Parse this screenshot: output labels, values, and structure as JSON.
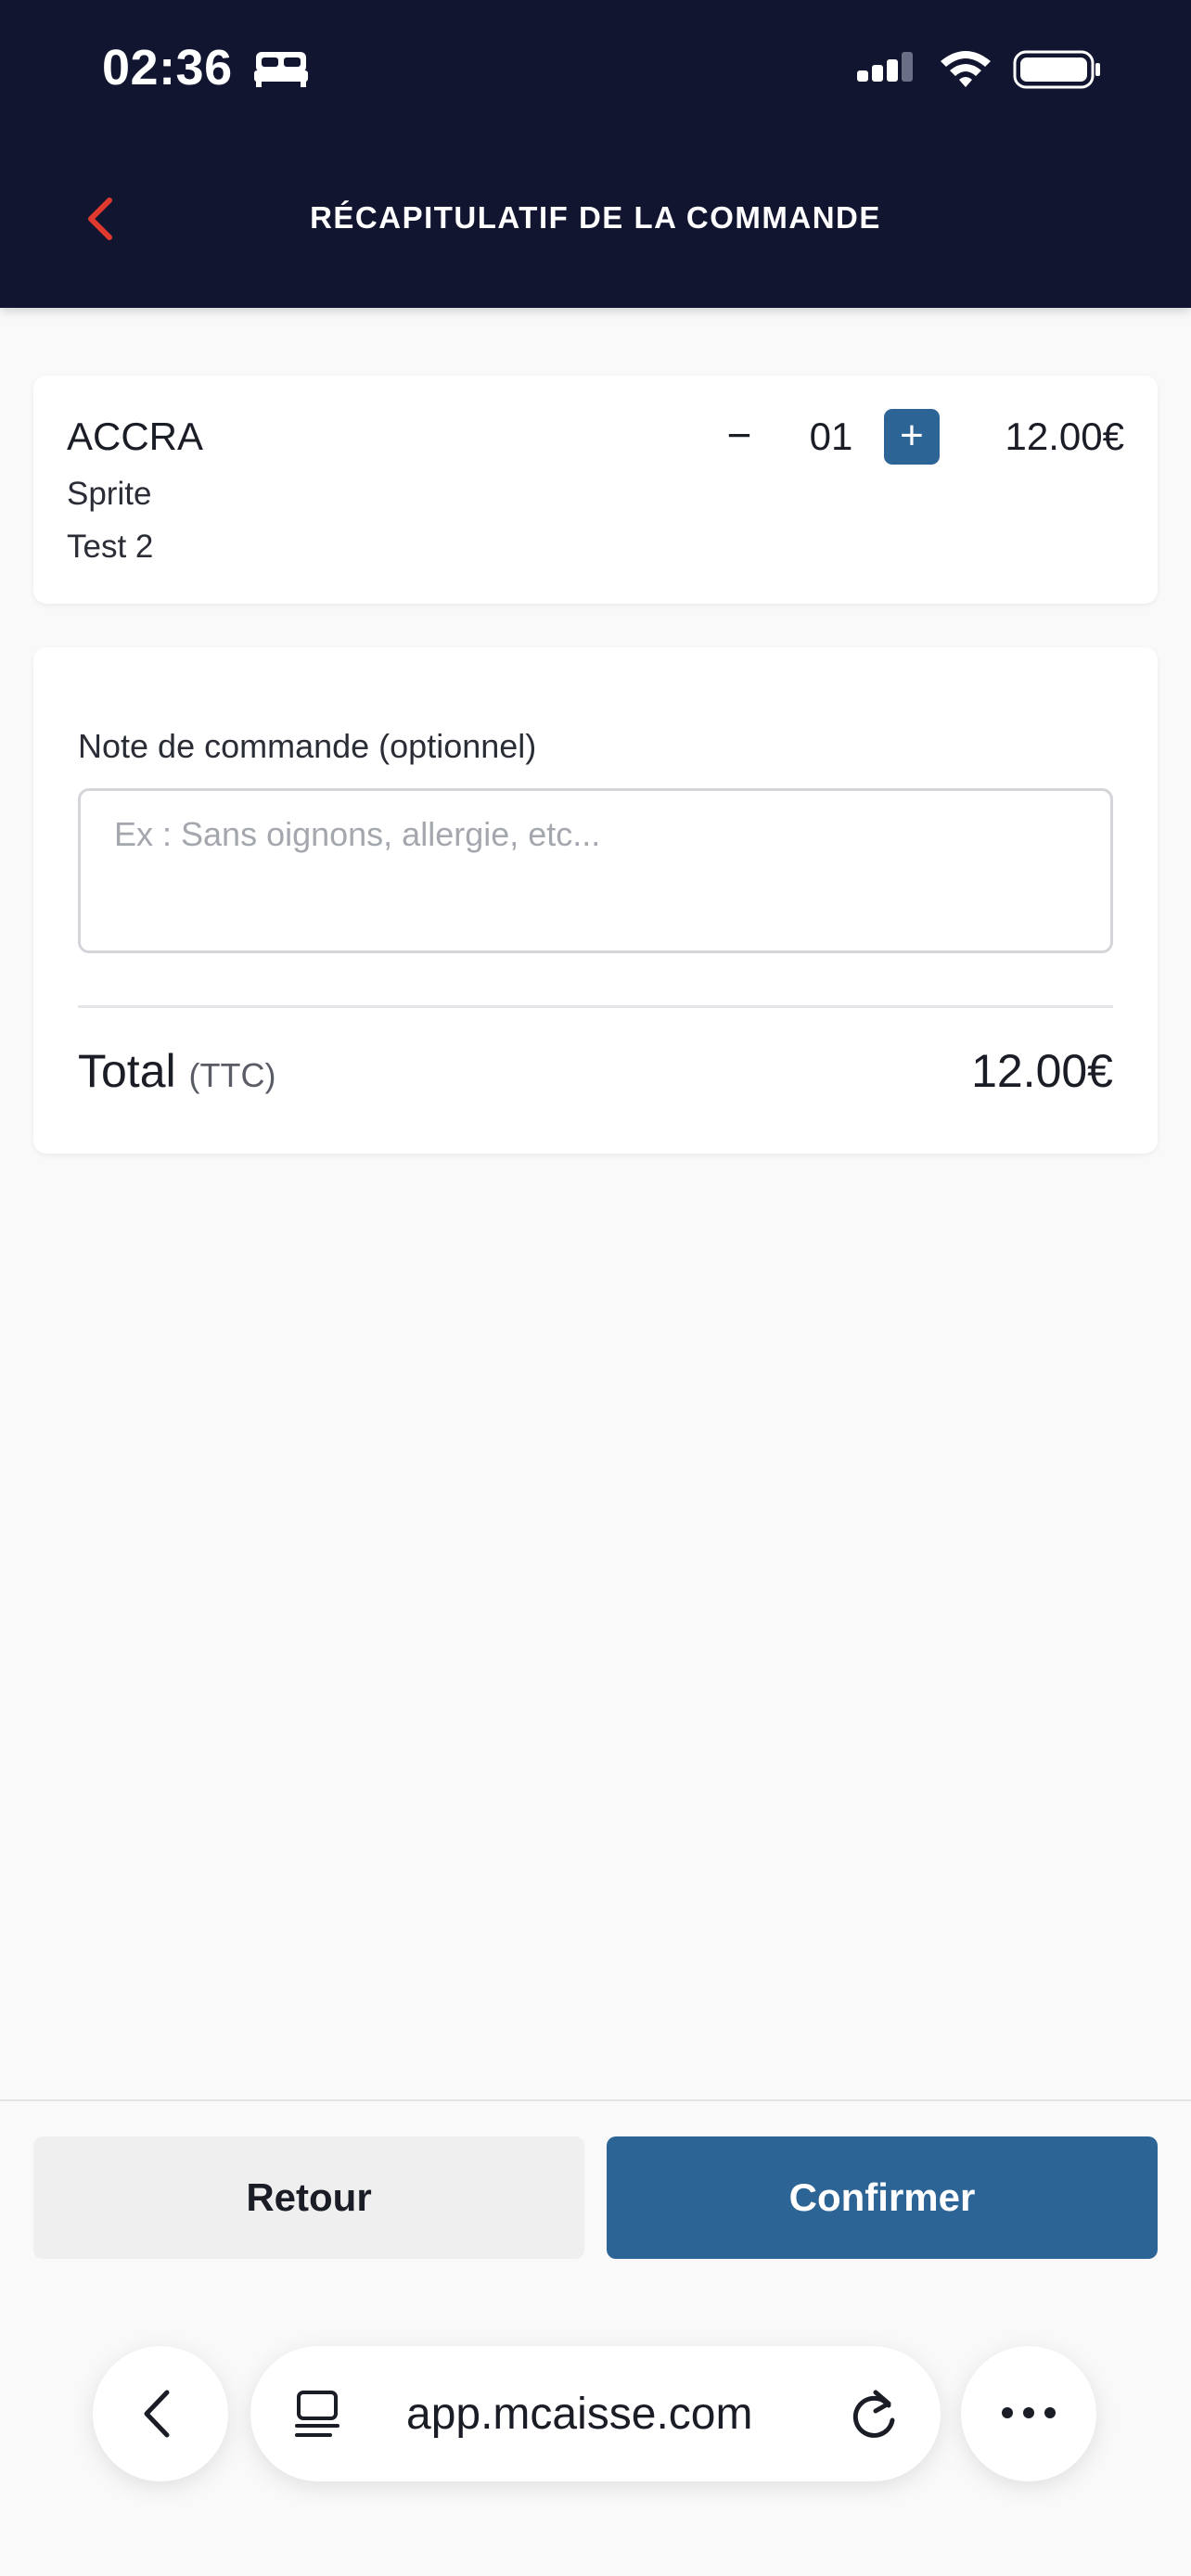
{
  "status_bar": {
    "time": "02:36",
    "icons": [
      "bed-icon",
      "signal-icon",
      "wifi-icon",
      "battery-icon"
    ]
  },
  "header": {
    "title": "RÉCAPITULATIF DE LA COMMANDE",
    "back_icon": "chevron-left-icon",
    "background_color": "#111530",
    "back_icon_color": "#e03a2f"
  },
  "order_item": {
    "name": "ACCRA",
    "options": [
      "Sprite",
      "Test 2"
    ],
    "minus_label": "−",
    "quantity": "01",
    "plus_label": "+",
    "price": "12.00€"
  },
  "note": {
    "label": "Note de commande (optionnel)",
    "placeholder": "Ex : Sans oignons, allergie, etc...",
    "value": ""
  },
  "total": {
    "label": "Total",
    "suffix": "(TTC)",
    "value": "12.00€"
  },
  "actions": {
    "back_label": "Retour",
    "confirm_label": "Confirmer",
    "accent_color": "#2d6496"
  },
  "browser": {
    "url": "app.mcaisse.com",
    "icons": [
      "chevron-left-icon",
      "tab-icon",
      "reload-icon",
      "more-icon"
    ]
  }
}
